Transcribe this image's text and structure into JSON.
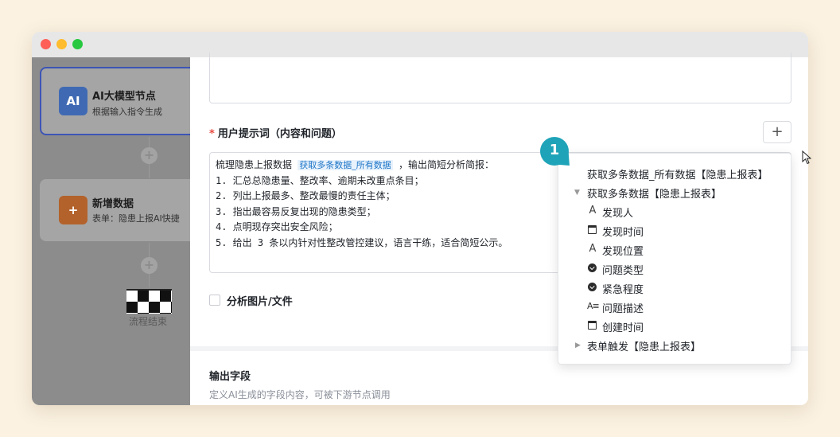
{
  "window": {
    "lights": [
      "close",
      "minimize",
      "maximize"
    ]
  },
  "canvas": {
    "ai_node": {
      "title": "AI大模型节点",
      "subtitle": "根据输入指令生成",
      "icon": "ai-icon"
    },
    "add_node": {
      "title": "新增数据",
      "subtitle": "表单：隐患上报AI快捷",
      "icon": "add-doc-icon"
    },
    "plus": "+",
    "end_label": "流程结束"
  },
  "panel": {
    "user_prompt_label": "用户提示词（内容和问题）",
    "required_mark": "*",
    "add_button": "+",
    "prompt_prefix": "梳理隐患上报数据 ",
    "prompt_variable": "获取多条数据_所有数据",
    "prompt_suffix": " ，输出简短分析简报：",
    "prompt_lines": [
      "1. 汇总总隐患量、整改率、逾期未改重点条目；",
      "2. 列出上报最多、整改最慢的责任主体；",
      "3. 指出最容易反复出现的隐患类型；",
      "4. 点明现存突出安全风险；",
      "5. 给出 3 条以内针对性整改管控建议，语言干练，适合简短公示。"
    ],
    "analyze_checkbox_label": "分析图片/文件",
    "output_title": "输出字段",
    "output_desc": "定义AI生成的字段内容，可被下游节点调用"
  },
  "dropdown": {
    "top_item": "获取多条数据_所有数据【隐患上报表】",
    "group_expanded": "获取多条数据【隐患上报表】",
    "fields": [
      {
        "label": "发现人",
        "icon": "text-icon"
      },
      {
        "label": "发现时间",
        "icon": "calendar-icon"
      },
      {
        "label": "发现位置",
        "icon": "text-icon"
      },
      {
        "label": "问题类型",
        "icon": "select-icon"
      },
      {
        "label": "紧急程度",
        "icon": "select-icon"
      },
      {
        "label": "问题描述",
        "icon": "multiline-text-icon"
      },
      {
        "label": "创建时间",
        "icon": "calendar-icon"
      }
    ],
    "group_collapsed": "表单触发【隐患上报表】"
  },
  "badge": {
    "number": "1",
    "color": "#1fa3b8"
  }
}
